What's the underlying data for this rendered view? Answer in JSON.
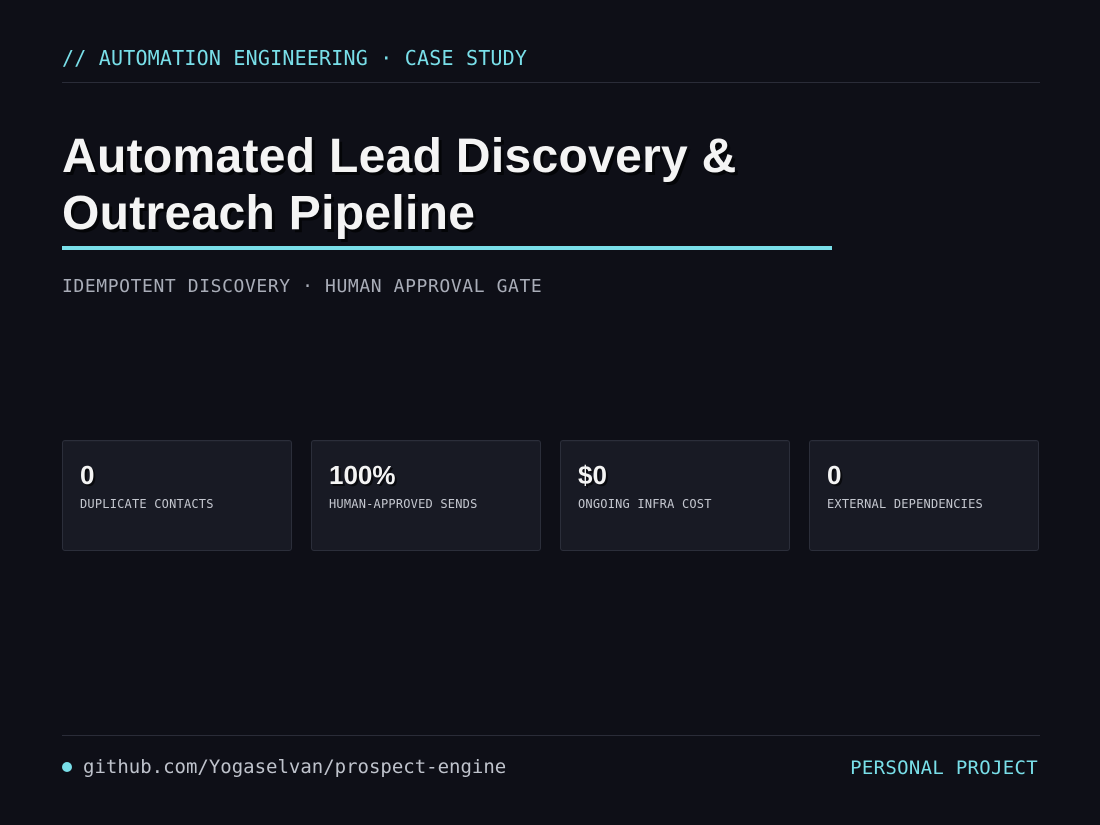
{
  "header": {
    "kicker": "// AUTOMATION ENGINEERING · CASE STUDY"
  },
  "hero": {
    "title_line1": "Automated Lead Discovery &",
    "title_line2": "Outreach Pipeline",
    "subtitle": "IDEMPOTENT DISCOVERY · HUMAN APPROVAL GATE"
  },
  "stats": [
    {
      "value": "0",
      "label": "DUPLICATE CONTACTS"
    },
    {
      "value": "100%",
      "label": "HUMAN-APPROVED SENDS"
    },
    {
      "value": "$0",
      "label": "ONGOING INFRA COST"
    },
    {
      "value": "0",
      "label": "EXTERNAL DEPENDENCIES"
    }
  ],
  "footer": {
    "repo": "github.com/Yogaselvan/prospect-engine",
    "badge": "PERSONAL PROJECT"
  },
  "colors": {
    "background": "#0e0f17",
    "accent": "#79dfe9",
    "card": "#181a24",
    "text": "#f4f4f4"
  }
}
